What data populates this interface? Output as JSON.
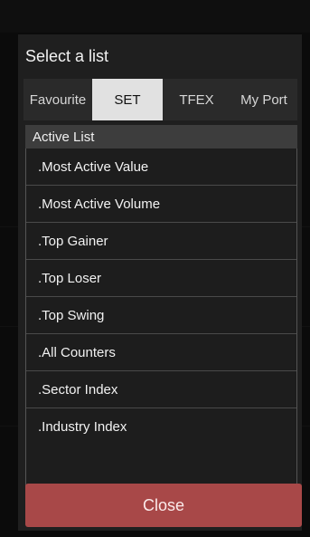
{
  "dialog": {
    "title": "Select a list",
    "tabs": [
      {
        "label": "Favourite",
        "active": false
      },
      {
        "label": "SET",
        "active": true
      },
      {
        "label": "TFEX",
        "active": false
      },
      {
        "label": "My Port",
        "active": false
      }
    ],
    "list_header": "Active List",
    "items": [
      {
        "label": ".Most Active Value"
      },
      {
        "label": ".Most Active Volume"
      },
      {
        "label": ".Top Gainer"
      },
      {
        "label": ".Top Loser"
      },
      {
        "label": ".Top Swing"
      },
      {
        "label": ".All Counters"
      },
      {
        "label": ".Sector Index"
      },
      {
        "label": ".Industry Index"
      }
    ],
    "close_label": "Close"
  },
  "colors": {
    "dialog_bg": "#1f1f1f",
    "active_tab": "#e1e1e1",
    "list_header_bg": "#3d3d3d",
    "close_button": "#a84848"
  }
}
